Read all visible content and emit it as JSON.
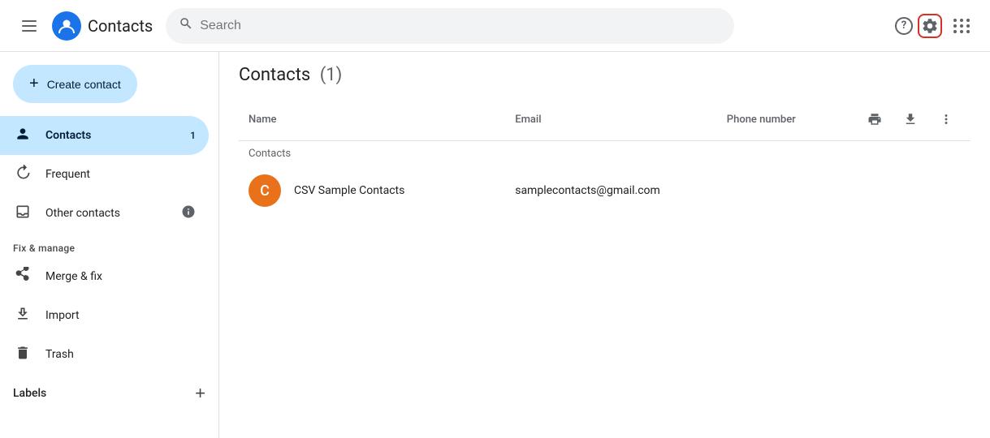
{
  "header": {
    "app_name": "Contacts",
    "search_placeholder": "Search"
  },
  "sidebar": {
    "create_button_label": "Create contact",
    "nav_items": [
      {
        "id": "contacts",
        "label": "Contacts",
        "badge": "1",
        "active": true,
        "icon": "person"
      },
      {
        "id": "frequent",
        "label": "Frequent",
        "badge": "",
        "active": false,
        "icon": "history"
      },
      {
        "id": "other-contacts",
        "label": "Other contacts",
        "badge": "",
        "active": false,
        "icon": "download-box",
        "info": true
      }
    ],
    "fix_manage_label": "Fix & manage",
    "fix_items": [
      {
        "id": "merge-fix",
        "label": "Merge & fix",
        "icon": "merge"
      },
      {
        "id": "import",
        "label": "Import",
        "icon": "import"
      },
      {
        "id": "trash",
        "label": "Trash",
        "icon": "trash"
      }
    ],
    "labels_label": "Labels",
    "add_label_icon": "+"
  },
  "main": {
    "title": "Contacts",
    "count": "(1)",
    "columns": {
      "name": "Name",
      "email": "Email",
      "phone": "Phone number"
    },
    "section_label": "Contacts",
    "contacts": [
      {
        "id": 1,
        "initials": "C",
        "name": "CSV Sample Contacts",
        "email": "samplecontacts@gmail.com",
        "phone": ""
      }
    ]
  }
}
